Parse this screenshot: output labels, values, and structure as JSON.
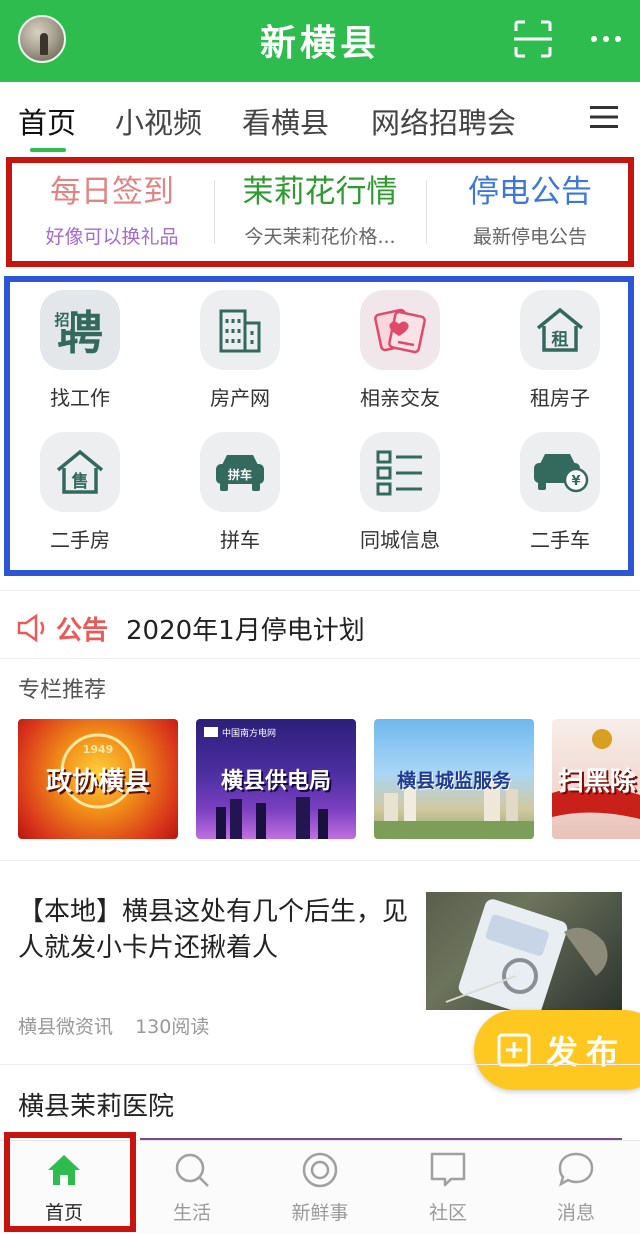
{
  "colors": {
    "header_bg": "#2fbc4f",
    "active_green": "#2fbc4f",
    "highlight_red": "#c6150f",
    "highlight_blue": "#2b57d6",
    "fab_yellow": "#ffc820"
  },
  "header": {
    "title": "新横县",
    "avatar": "avatar-photo",
    "right_icons": [
      "scan-icon",
      "more-icon"
    ]
  },
  "tabs": {
    "items": [
      {
        "label": "首页",
        "active": true
      },
      {
        "label": "小视频"
      },
      {
        "label": "看横县"
      },
      {
        "label": "网络招聘会"
      }
    ],
    "menu_icon": "menu-icon"
  },
  "quick_links": [
    {
      "title": "每日签到",
      "subtitle": "好像可以换礼品",
      "title_color": "#e08585",
      "subtitle_color": "#a66bd1"
    },
    {
      "title": "茉莉花行情",
      "subtitle": "今天茉莉花价格...",
      "title_color": "#2f9a2f",
      "subtitle_color": "#666666"
    },
    {
      "title": "停电公告",
      "subtitle": "最新停电公告",
      "title_color": "#3d78d8",
      "subtitle_color": "#666666"
    }
  ],
  "services": [
    {
      "label": "找工作",
      "icon": "hire-icon"
    },
    {
      "label": "房产网",
      "icon": "building-icon"
    },
    {
      "label": "相亲交友",
      "icon": "dating-cards-icon"
    },
    {
      "label": "租房子",
      "icon": "rent-house-icon"
    },
    {
      "label": "二手房",
      "icon": "sale-house-icon"
    },
    {
      "label": "拼车",
      "icon": "carpool-icon"
    },
    {
      "label": "同城信息",
      "icon": "list-icon"
    },
    {
      "label": "二手车",
      "icon": "used-car-icon"
    }
  ],
  "service_glyphs": {
    "hire_big": "聘",
    "hire_small": "招",
    "rent": "租",
    "sale": "售",
    "carpool": "拼车",
    "yen": "¥"
  },
  "notice": {
    "tag": "公告",
    "text": "2020年1月停电计划",
    "icon": "speaker-icon"
  },
  "featured": {
    "title": "专栏推荐",
    "banners": [
      {
        "label": "政协横县",
        "badge": "1949"
      },
      {
        "label": "横县供电局",
        "badge": "中国南方电网"
      },
      {
        "label": "横县城监服务"
      },
      {
        "label": "扫黑除"
      }
    ]
  },
  "article": {
    "title": "【本地】横县这处有几个后生，见人就发小卡片还揪着人",
    "source": "横县微资讯",
    "reads": "130阅读"
  },
  "fab": {
    "label": "发布",
    "icon": "plus-square-icon"
  },
  "next_article": {
    "title": "横县茉莉医院"
  },
  "bottom_nav": [
    {
      "label": "首页",
      "icon": "home-icon",
      "active": true
    },
    {
      "label": "生活",
      "icon": "search-icon"
    },
    {
      "label": "新鲜事",
      "icon": "target-icon"
    },
    {
      "label": "社区",
      "icon": "chat-box-icon"
    },
    {
      "label": "消息",
      "icon": "message-icon"
    }
  ]
}
